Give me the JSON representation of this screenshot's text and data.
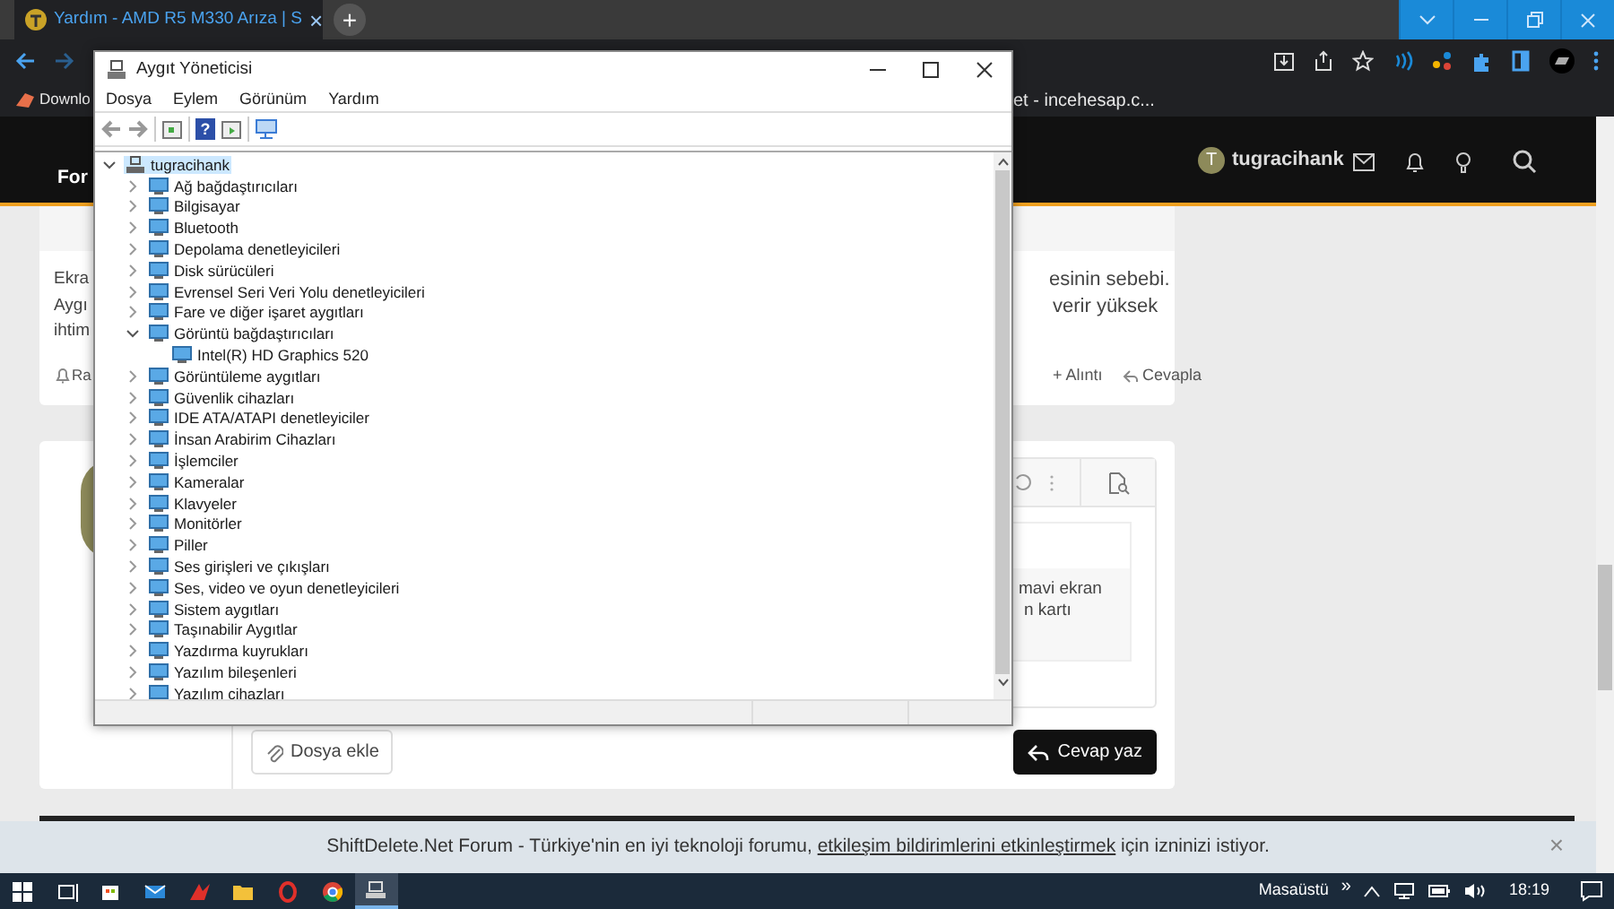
{
  "browser": {
    "tab": {
      "title": "Yardım - AMD R5 M330 Arıza | S",
      "close": "×",
      "selected": true
    },
    "new_tab": "+",
    "bookmarks": [
      {
        "label": "Downlo"
      },
      {
        "label": "et - incehesap.c..."
      }
    ]
  },
  "forum": {
    "header_label": "For",
    "user": {
      "initial": "T",
      "name": "tugracihank"
    },
    "post": {
      "lines_left": [
        "Ekra",
        "Aygı",
        "ihtim"
      ],
      "lines_right": [
        "esinin sebebi.",
        "verir yüksek"
      ],
      "report": "Ra",
      "quote": "+ Alıntı",
      "reply": "Cevapla"
    },
    "editor": {
      "lines": [
        "mavi ekran",
        "n kartı"
      ],
      "attach": "Dosya ekle",
      "submit": "Cevap yaz"
    }
  },
  "notification": {
    "before": "ShiftDelete.Net Forum - Türkiye'nin en iyi teknoloji forumu, ",
    "link": "etkileşim bildirimlerini etkinleştirmek",
    "after": " için izninizi istiyor.",
    "close": "×"
  },
  "device_manager": {
    "title": "Aygıt Yöneticisi",
    "help_glyph": "?",
    "menu": [
      "Dosya",
      "Eylem",
      "Görünüm",
      "Yardım"
    ],
    "tree": {
      "label": "tugracihank",
      "expanded": true,
      "selected": true,
      "children": [
        {
          "label": "Ağ bağdaştırıcıları",
          "expanded": false,
          "selected": false
        },
        {
          "label": "Bilgisayar",
          "expanded": false,
          "selected": false
        },
        {
          "label": "Bluetooth",
          "expanded": false,
          "selected": false
        },
        {
          "label": "Depolama denetleyicileri",
          "expanded": false,
          "selected": false
        },
        {
          "label": "Disk sürücüleri",
          "expanded": false,
          "selected": false
        },
        {
          "label": "Evrensel Seri Veri Yolu denetleyicileri",
          "expanded": false,
          "selected": false
        },
        {
          "label": "Fare ve diğer işaret aygıtları",
          "expanded": false,
          "selected": false
        },
        {
          "label": "Görüntü bağdaştırıcıları",
          "expanded": true,
          "selected": false,
          "children": [
            {
              "label": "Intel(R) HD Graphics 520",
              "selected": false
            }
          ]
        },
        {
          "label": "Görüntüleme aygıtları",
          "expanded": false,
          "selected": false
        },
        {
          "label": "Güvenlik cihazları",
          "expanded": false,
          "selected": false
        },
        {
          "label": "IDE ATA/ATAPI denetleyiciler",
          "expanded": false,
          "selected": false
        },
        {
          "label": "İnsan Arabirim Cihazları",
          "expanded": false,
          "selected": false
        },
        {
          "label": "İşlemciler",
          "expanded": false,
          "selected": false
        },
        {
          "label": "Kameralar",
          "expanded": false,
          "selected": false
        },
        {
          "label": "Klavyeler",
          "expanded": false,
          "selected": false
        },
        {
          "label": "Monitörler",
          "expanded": false,
          "selected": false
        },
        {
          "label": "Piller",
          "expanded": false,
          "selected": false
        },
        {
          "label": "Ses girişleri ve çıkışları",
          "expanded": false,
          "selected": false
        },
        {
          "label": "Ses, video ve oyun denetleyicileri",
          "expanded": false,
          "selected": false
        },
        {
          "label": "Sistem aygıtları",
          "expanded": false,
          "selected": false
        },
        {
          "label": "Taşınabilir Aygıtlar",
          "expanded": false,
          "selected": false
        },
        {
          "label": "Yazdırma kuyrukları",
          "expanded": false,
          "selected": false
        },
        {
          "label": "Yazılım bileşenleri",
          "expanded": false,
          "selected": false
        },
        {
          "label": "Yazılım cihazları",
          "expanded": false,
          "selected": false
        }
      ]
    }
  },
  "taskbar": {
    "desktop_label": "Masaüstü",
    "overflow": "»",
    "time": "18:19"
  }
}
